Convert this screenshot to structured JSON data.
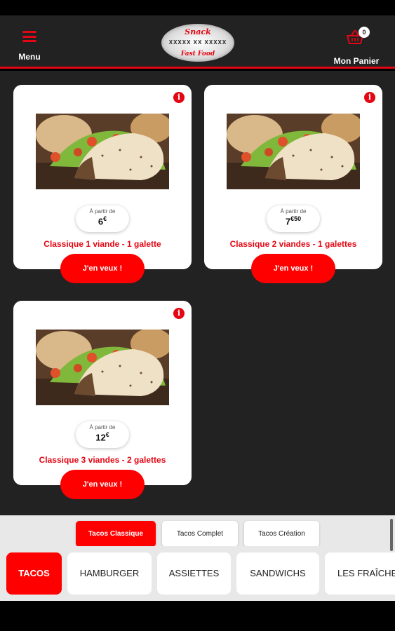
{
  "header": {
    "menu_label": "Menu",
    "cart_label": "Mon Panier",
    "cart_count": "0",
    "logo": {
      "top": "Snack",
      "middle": "XXXXX XX XXXXX",
      "bottom": "Fast Food"
    }
  },
  "products": [
    {
      "from_label": "À partir de",
      "price_main": "6",
      "price_sup": "€",
      "name": "Classique 1 viande - 1 galette",
      "cta": "J'en veux !"
    },
    {
      "from_label": "À partir de",
      "price_main": "7",
      "price_sup": "€50",
      "name": "Classique 2 viandes - 1 galettes",
      "cta": "J'en veux !"
    },
    {
      "from_label": "À partir de",
      "price_main": "12",
      "price_sup": "€",
      "name": "Classique 3 viandes - 2 galettes",
      "cta": "J'en veux !"
    }
  ],
  "subcategories": [
    {
      "label": "Tacos Classique",
      "active": true
    },
    {
      "label": "Tacos Complet",
      "active": false
    },
    {
      "label": "Tacos Création",
      "active": false
    }
  ],
  "categories": [
    {
      "label": "TACOS",
      "active": true
    },
    {
      "label": "HAMBURGER",
      "active": false
    },
    {
      "label": "ASSIETTES",
      "active": false
    },
    {
      "label": "SANDWICHS",
      "active": false
    },
    {
      "label": "LES FRAÎCHE",
      "active": false
    }
  ],
  "colors": {
    "accent": "#ff0000",
    "header_bg": "#222222",
    "title_red": "#e30613"
  }
}
